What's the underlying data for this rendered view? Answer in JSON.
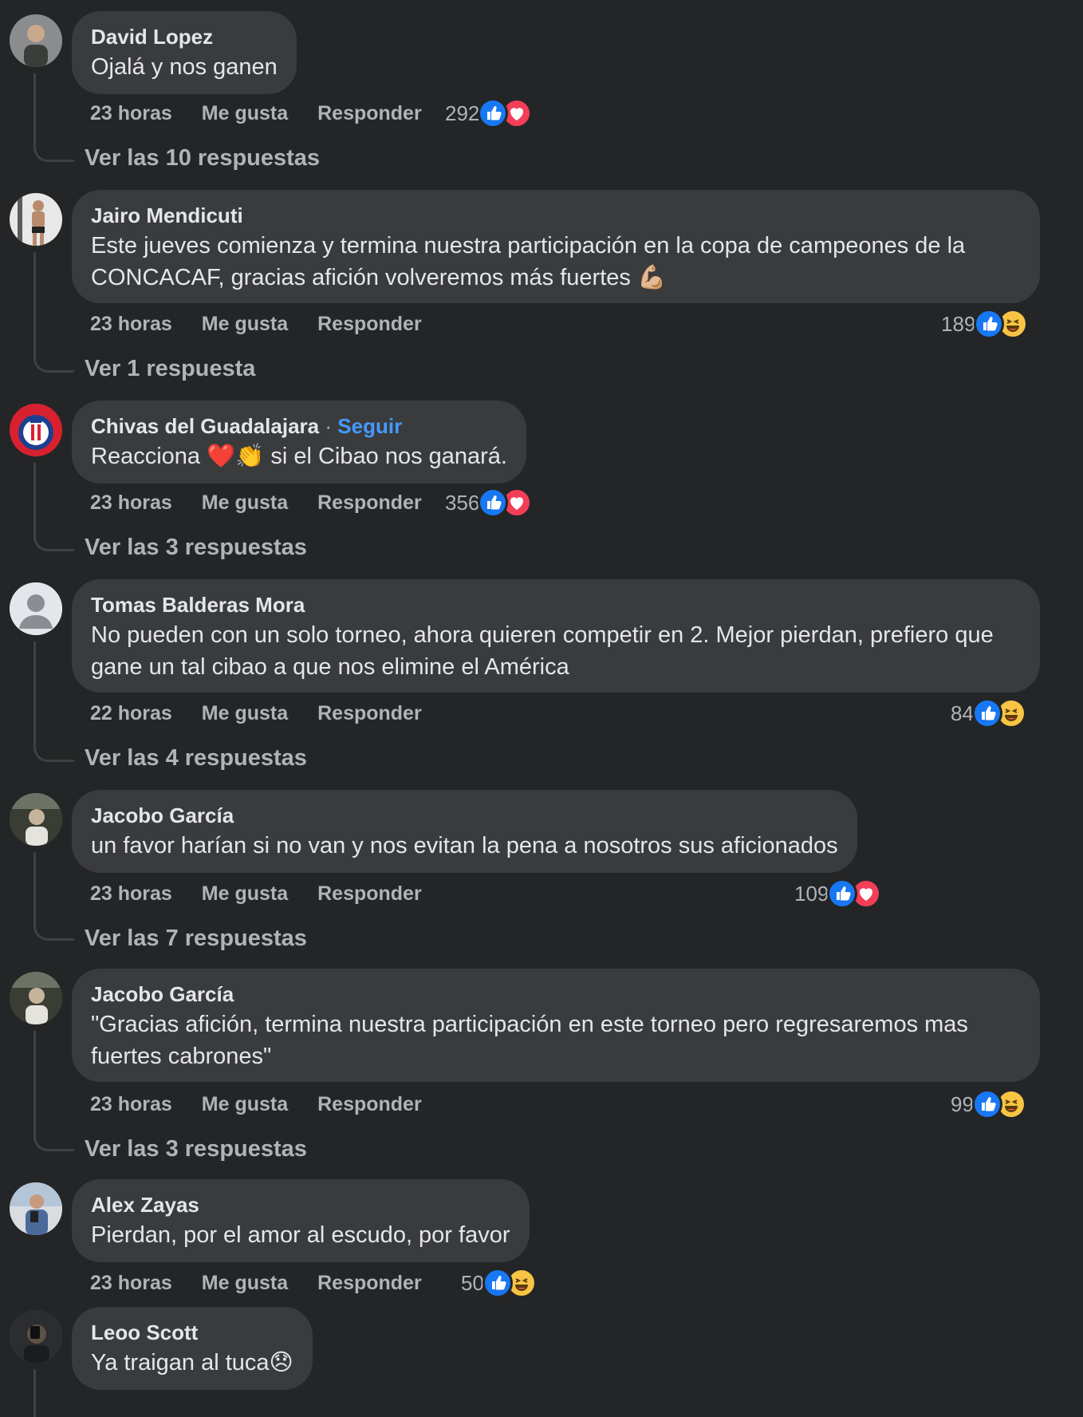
{
  "reaction_icons": {
    "like": "thumbs-up-icon",
    "love": "heart-icon",
    "haha": "laughing-face-icon"
  },
  "colors": {
    "background": "#242526",
    "bubble": "#3a3b3c",
    "like": "#1877f2",
    "love": "#f33e58",
    "haha": "#f7c444",
    "follow": "#4599ff"
  },
  "comments": [
    {
      "author": "David Lopez",
      "text": "Ojalá y nos ganen",
      "time": "23 horas",
      "like_label": "Me gusta",
      "reply_label": "Responder",
      "reaction_count": "292",
      "reactions": [
        "like",
        "love"
      ],
      "view_replies": "Ver las 10 respuestas"
    },
    {
      "author": "Jairo Mendicuti",
      "text": "Este jueves comienza y termina nuestra participación en la copa de campeones de la CONCACAF, gracias afición volveremos más fuertes 💪🏼",
      "time": "23 horas",
      "like_label": "Me gusta",
      "reply_label": "Responder",
      "reaction_count": "189",
      "reactions": [
        "like",
        "haha"
      ],
      "view_replies": "Ver 1 respuesta"
    },
    {
      "author": "Chivas del Guadalajara",
      "follow": "Seguir",
      "separator": "·",
      "text": "Reacciona ❤️👏 si el Cibao nos ganará.",
      "time": "23 horas",
      "like_label": "Me gusta",
      "reply_label": "Responder",
      "reaction_count": "356",
      "reactions": [
        "like",
        "love"
      ],
      "view_replies": "Ver las 3 respuestas"
    },
    {
      "author": "Tomas Balderas Mora",
      "text": "No pueden con un solo torneo, ahora quieren competir en 2. Mejor pierdan, prefiero que gane un tal cibao a que nos elimine el América",
      "time": "22 horas",
      "like_label": "Me gusta",
      "reply_label": "Responder",
      "reaction_count": "84",
      "reactions": [
        "like",
        "haha"
      ],
      "view_replies": "Ver las 4 respuestas"
    },
    {
      "author": "Jacobo García",
      "text": "un favor harían si no van y nos evitan la pena a nosotros sus aficionados",
      "time": "23 horas",
      "like_label": "Me gusta",
      "reply_label": "Responder",
      "reaction_count": "109",
      "reactions": [
        "like",
        "love"
      ],
      "view_replies": "Ver las 7 respuestas"
    },
    {
      "author": "Jacobo García",
      "text": "\"Gracias afición, termina nuestra participación en este torneo pero regresaremos mas fuertes cabrones\"",
      "time": "23 horas",
      "like_label": "Me gusta",
      "reply_label": "Responder",
      "reaction_count": "99",
      "reactions": [
        "like",
        "haha"
      ],
      "view_replies": "Ver las 3 respuestas"
    },
    {
      "author": "Alex Zayas",
      "text": "Pierdan, por el amor al escudo, por favor",
      "time": "23 horas",
      "like_label": "Me gusta",
      "reply_label": "Responder",
      "reaction_count": "50",
      "reactions": [
        "like",
        "haha"
      ]
    },
    {
      "author": "Leoo Scott",
      "text": "Ya traigan al tuca😞"
    }
  ]
}
